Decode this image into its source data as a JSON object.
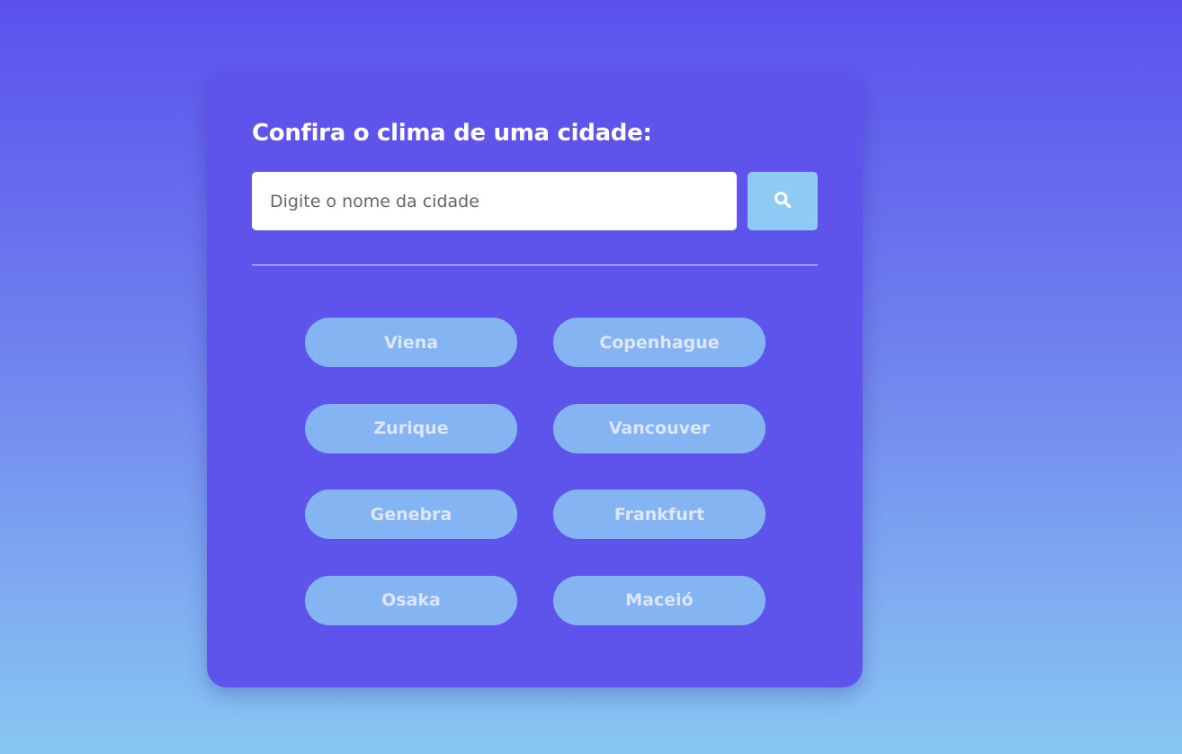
{
  "search": {
    "title": "Confira o clima de uma cidade:",
    "placeholder": "Digite o nome da cidade",
    "value": "",
    "button_icon": "search-icon"
  },
  "cities": [
    {
      "label": "Viena"
    },
    {
      "label": "Copenhague"
    },
    {
      "label": "Zurique"
    },
    {
      "label": "Vancouver"
    },
    {
      "label": "Genebra"
    },
    {
      "label": "Frankfurt"
    },
    {
      "label": "Osaka"
    },
    {
      "label": "Maceió"
    }
  ],
  "colors": {
    "background_top": "#5b51ee",
    "background_bottom": "#88c7f3",
    "card": "#5e54ec",
    "search_button": "#8ecbf4",
    "city_button": "#84b5f2",
    "city_text": "#dde6fb"
  }
}
